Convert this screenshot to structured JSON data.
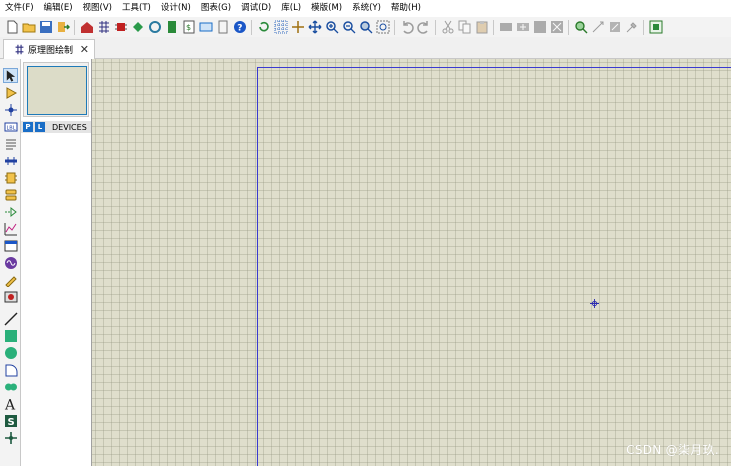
{
  "menu": {
    "items": [
      "文件(F)",
      "编辑(E)",
      "视图(V)",
      "工具(T)",
      "设计(N)",
      "图表(G)",
      "调试(D)",
      "库(L)",
      "模版(M)",
      "系统(Y)",
      "帮助(H)"
    ]
  },
  "tab": {
    "label": "原理图绘制",
    "close": "✕"
  },
  "panel": {
    "pick_label": "P",
    "lib_label": "L",
    "devices_label": "DEVICES"
  },
  "watermark": "CSDN @柒月玖.",
  "colors": {
    "canvas": "#dfdecc",
    "sheet_border": "#3a3ad0",
    "accent": "#1a6ec7"
  }
}
